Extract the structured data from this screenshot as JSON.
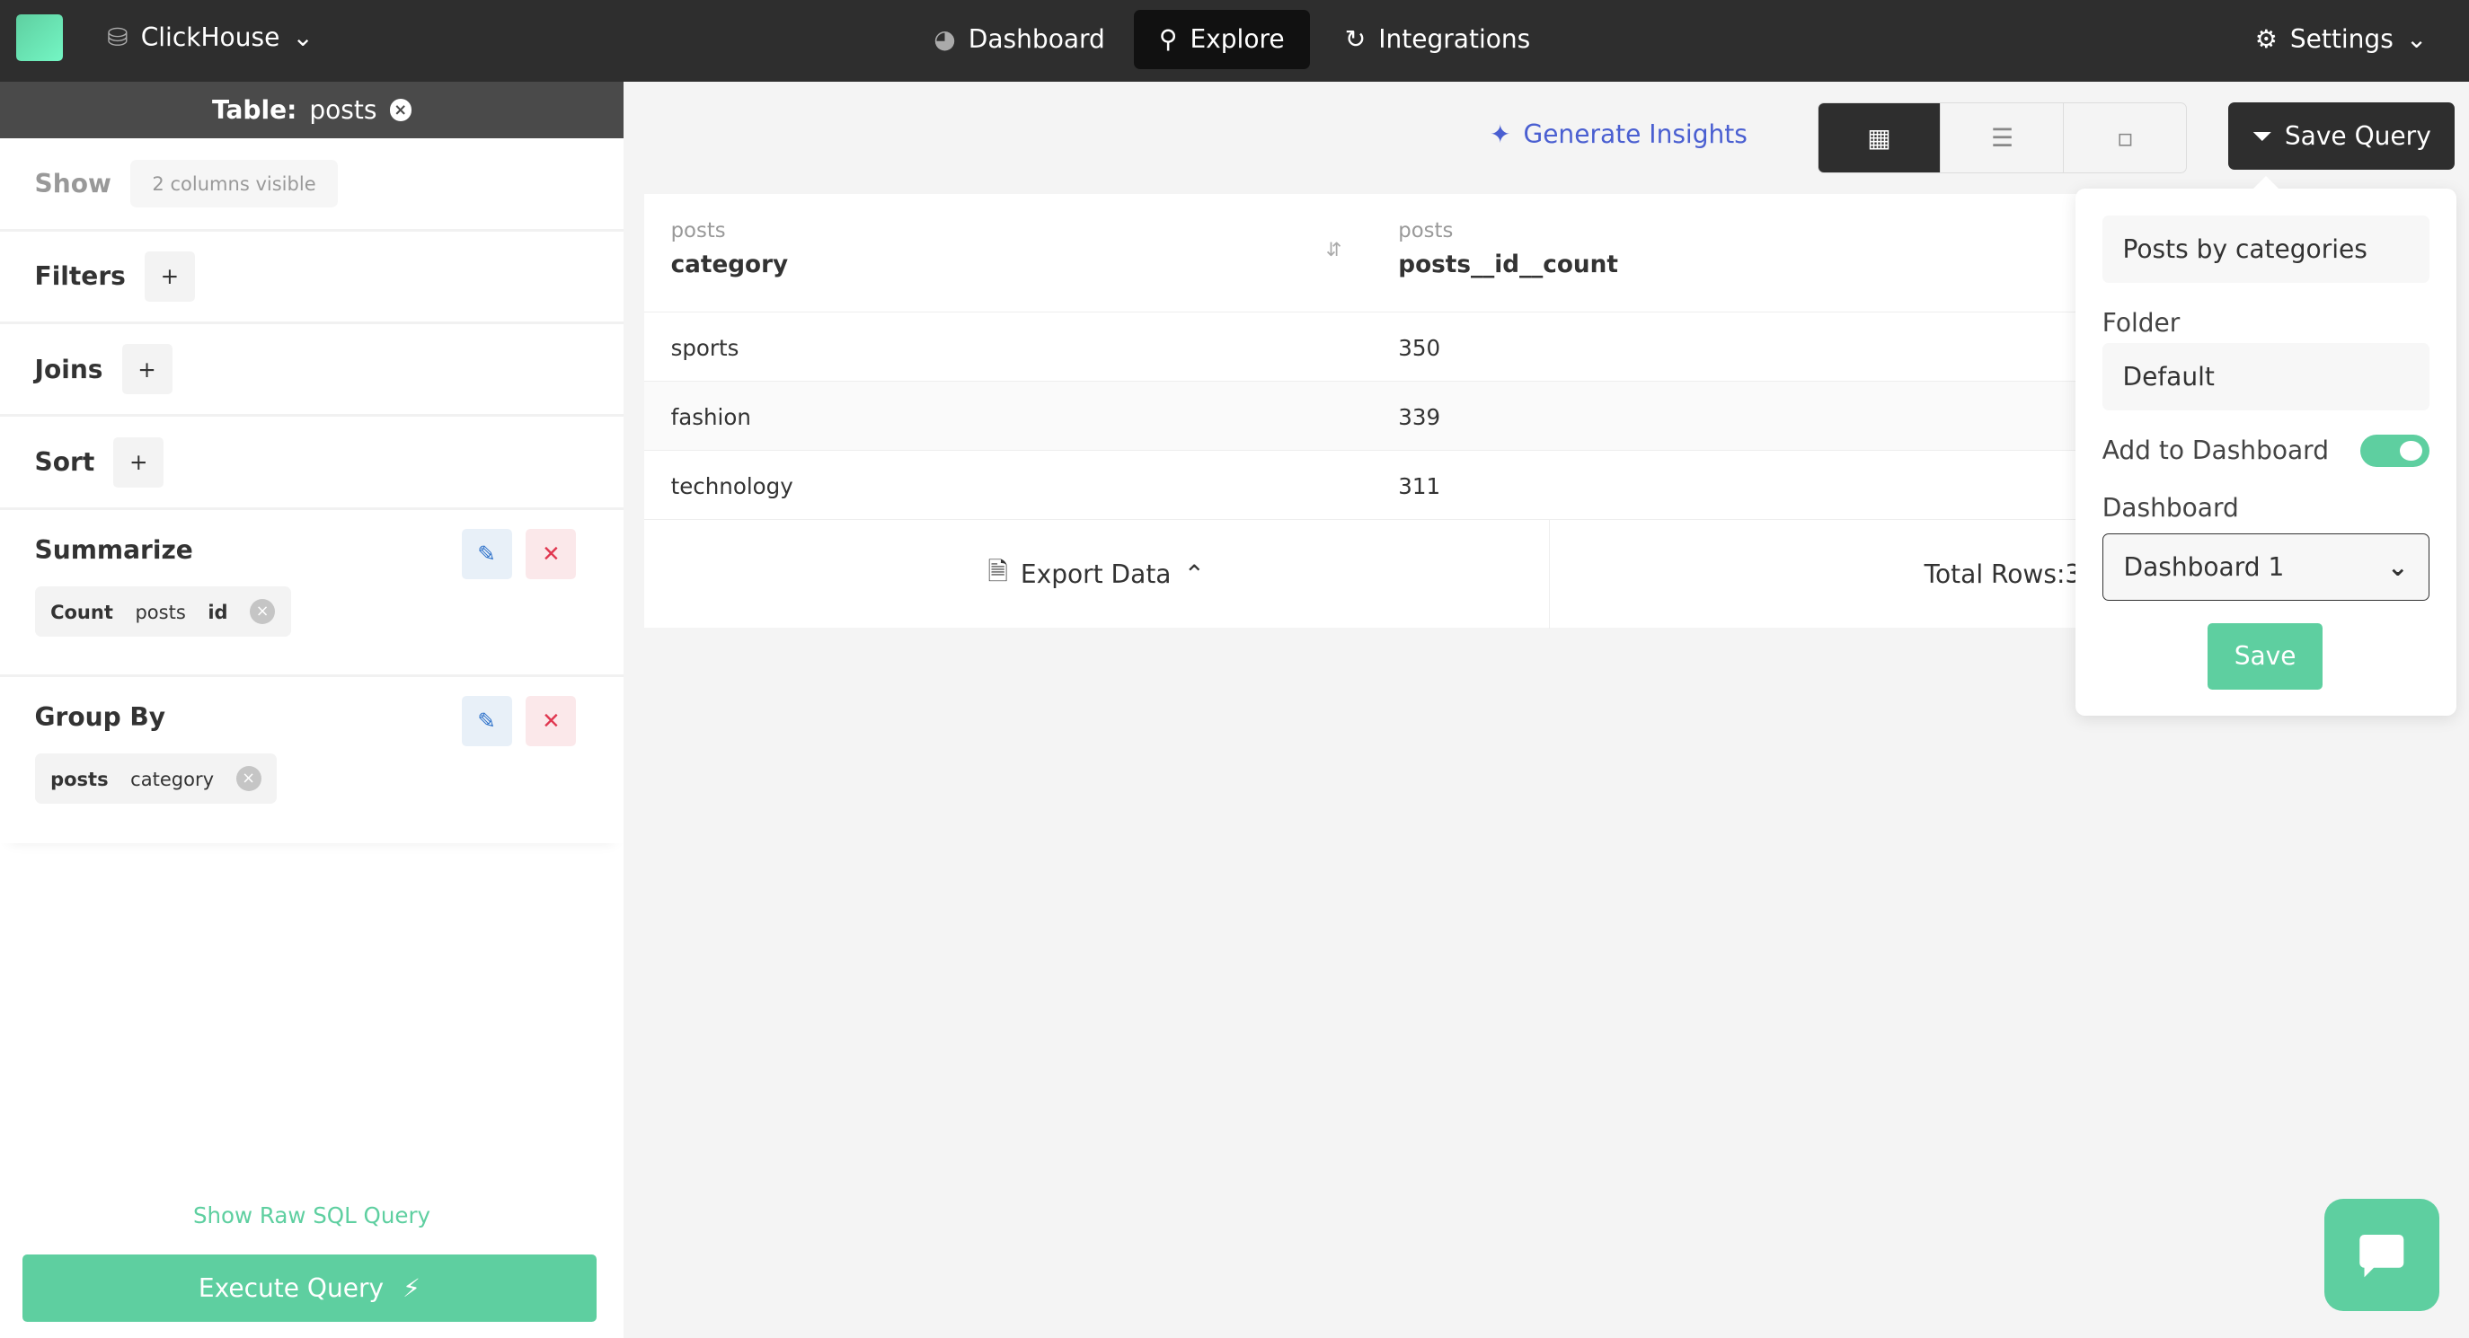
{
  "topbar": {
    "datasource": "ClickHouse",
    "nav": [
      {
        "label": "Dashboard"
      },
      {
        "label": "Explore"
      },
      {
        "label": "Integrations"
      }
    ],
    "settings": "Settings"
  },
  "sidebar": {
    "table_prefix": "Table:",
    "table_name": "posts",
    "show_label": "Show",
    "columns_visible": "2 columns visible",
    "filters": "Filters",
    "joins": "Joins",
    "sort": "Sort",
    "plus": "+",
    "summarize": {
      "label": "Summarize",
      "chip": [
        "Count",
        "posts",
        "id"
      ]
    },
    "group_by": {
      "label": "Group By",
      "chip": [
        "posts",
        "category"
      ]
    },
    "raw_sql": "Show Raw SQL Query",
    "execute": "Execute Query"
  },
  "toolbar": {
    "insights": "Generate Insights",
    "save_query": "Save Query"
  },
  "table": {
    "columns": [
      {
        "table": "posts",
        "name": "category"
      },
      {
        "table": "posts",
        "name": "posts__id__count"
      }
    ],
    "rows": [
      [
        "sports",
        "350"
      ],
      [
        "fashion",
        "339"
      ],
      [
        "technology",
        "311"
      ]
    ],
    "export": "Export Data",
    "total_rows": "Total Rows:3"
  },
  "save_popup": {
    "name": "Posts by categories",
    "folder_label": "Folder",
    "folder": "Default",
    "add_to_dashboard": "Add to Dashboard",
    "add_to_dashboard_on": true,
    "dashboard_label": "Dashboard",
    "dashboard": "Dashboard 1",
    "save": "Save"
  },
  "colors": {
    "accent": "#5ecfa0",
    "dark": "#2e2e2e",
    "insights": "#4a5fd1",
    "danger": "#e0364f"
  }
}
